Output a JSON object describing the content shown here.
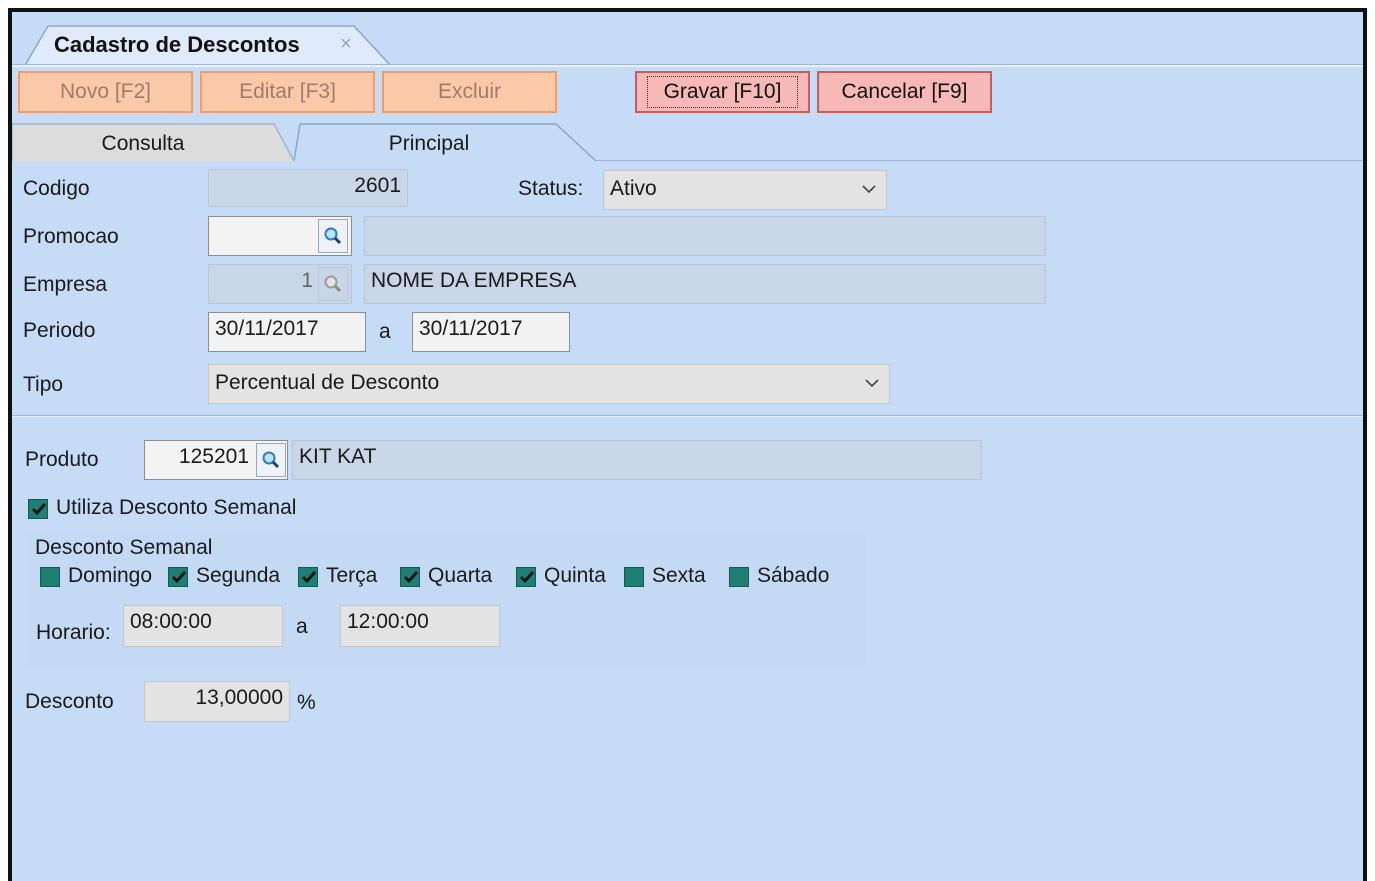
{
  "window_tab": {
    "title": "Cadastro de Descontos",
    "close": "×"
  },
  "toolbar": {
    "novo": "Novo [F2]",
    "editar": "Editar [F3]",
    "excluir": "Excluir",
    "gravar": "Gravar [F10]",
    "cancelar": "Cancelar [F9]"
  },
  "tabs": {
    "consulta": "Consulta",
    "principal": "Principal"
  },
  "form": {
    "codigo_label": "Codigo",
    "codigo_value": "2601",
    "status_label": "Status:",
    "status_value": "Ativo",
    "promocao_label": "Promocao",
    "promocao_value": "",
    "promocao_desc": "",
    "empresa_label": "Empresa",
    "empresa_value": "1",
    "empresa_desc": "NOME DA EMPRESA",
    "periodo_label": "Periodo",
    "periodo_from": "30/11/2017",
    "periodo_sep": "a",
    "periodo_to": "30/11/2017",
    "tipo_label": "Tipo",
    "tipo_value": "Percentual de Desconto"
  },
  "product": {
    "produto_label": "Produto",
    "produto_code": "125201",
    "produto_desc": "KIT KAT",
    "utiliza_label": "Utiliza Desconto Semanal",
    "utiliza_checked": true,
    "semanal_title": "Desconto Semanal",
    "days": [
      {
        "label": "Domingo",
        "checked": false
      },
      {
        "label": "Segunda",
        "checked": true
      },
      {
        "label": "Terça",
        "checked": true
      },
      {
        "label": "Quarta",
        "checked": true
      },
      {
        "label": "Quinta",
        "checked": true
      },
      {
        "label": "Sexta",
        "checked": false
      },
      {
        "label": "Sábado",
        "checked": false
      }
    ],
    "horario_label": "Horario:",
    "horario_from": "08:00:00",
    "horario_sep": "a",
    "horario_to": "12:00:00",
    "desconto_label": "Desconto",
    "desconto_value": "13,00000",
    "desconto_unit": "%"
  },
  "colors": {
    "background": "#c6dbf6",
    "button_disabled": "#fbc8a8",
    "button_active": "#f6b9b7",
    "checkbox": "#1e7f73"
  }
}
